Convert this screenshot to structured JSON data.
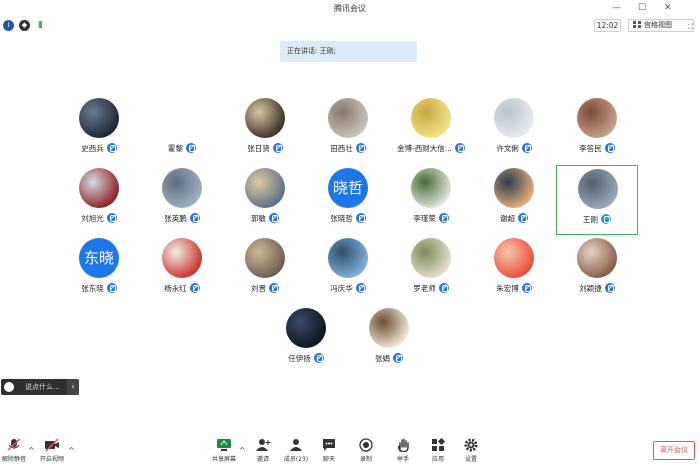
{
  "window": {
    "title": "腾讯会议"
  },
  "top": {
    "time": "12:02",
    "view_label": "宫格视图"
  },
  "speaking": {
    "text": "正在讲话: 王刚;"
  },
  "participants": [
    {
      "name": "史西兵",
      "avatar": "photo",
      "colors": [
        "#1c2433",
        "#6b7c91"
      ]
    },
    {
      "name": "霍黎",
      "avatar": "none",
      "colors": [
        "#ffffff",
        "#ffffff"
      ]
    },
    {
      "name": "张日贤",
      "avatar": "photo",
      "colors": [
        "#3b2f25",
        "#d8c7a5"
      ]
    },
    {
      "name": "田西壮",
      "avatar": "photo",
      "colors": [
        "#c9c4be",
        "#8a7768"
      ]
    },
    {
      "name": "金博-西财大信...",
      "avatar": "photo",
      "colors": [
        "#f2e28a",
        "#c8a83d"
      ]
    },
    {
      "name": "许文俐",
      "avatar": "photo",
      "colors": [
        "#e8ecef",
        "#b8c2c9"
      ]
    },
    {
      "name": "李答民",
      "avatar": "photo",
      "colors": [
        "#caa08a",
        "#7a4a3a"
      ]
    },
    {
      "name": "刘旭光",
      "avatar": "photo",
      "colors": [
        "#8c1f1f",
        "#d4dbe3"
      ]
    },
    {
      "name": "张英鹏",
      "avatar": "photo",
      "colors": [
        "#9fb0c2",
        "#5d6e80"
      ]
    },
    {
      "name": "郭敏",
      "avatar": "photo",
      "colors": [
        "#5b6f85",
        "#e0c9a4"
      ]
    },
    {
      "name": "张晓哲",
      "avatar": "text",
      "text": "晓哲"
    },
    {
      "name": "李瑾荣",
      "avatar": "photo",
      "colors": [
        "#dfe9d8",
        "#4c6b3d"
      ]
    },
    {
      "name": "谢超",
      "avatar": "photo",
      "colors": [
        "#e6b07a",
        "#2d3b4d"
      ]
    },
    {
      "name": "王刚",
      "avatar": "photo",
      "colors": [
        "#9ba9b8",
        "#4f5d6c"
      ]
    },
    {
      "name": "张东晓",
      "avatar": "text",
      "text": "东晓"
    },
    {
      "name": "杨永红",
      "avatar": "photo",
      "colors": [
        "#c9302c",
        "#f1efe7"
      ]
    },
    {
      "name": "刘晋",
      "avatar": "photo",
      "colors": [
        "#6d5d4e",
        "#cdb89a"
      ]
    },
    {
      "name": "冯庆华",
      "avatar": "photo",
      "colors": [
        "#7fb3d8",
        "#2c4f6b"
      ]
    },
    {
      "name": "罗老师",
      "avatar": "photo",
      "colors": [
        "#e8dfd2",
        "#7d8a5a"
      ]
    },
    {
      "name": "朱宏博",
      "avatar": "photo",
      "colors": [
        "#e94b3c",
        "#f6c7a9"
      ]
    },
    {
      "name": "刘颖捷",
      "avatar": "photo",
      "colors": [
        "#8a5a47",
        "#e3d3c6"
      ]
    },
    {
      "name": "任伊扬",
      "avatar": "photo",
      "colors": [
        "#0e1420",
        "#3a4a66"
      ]
    },
    {
      "name": "张娟",
      "avatar": "photo",
      "colors": [
        "#f1ead8",
        "#6b4e33"
      ]
    }
  ],
  "chat": {
    "placeholder": "说点什么..."
  },
  "bottom": {
    "unmute": "解除静音",
    "video": "开启视频",
    "share": "共享屏幕",
    "invite": "邀请",
    "members": "成员(23)",
    "chat": "聊天",
    "record": "录制",
    "hand": "举手",
    "apps": "应用",
    "settings": "设置",
    "leave": "离开会议"
  },
  "colors": {
    "accent": "#2a72d4",
    "active_border": "#3fb35c",
    "leave": "#e35353"
  }
}
